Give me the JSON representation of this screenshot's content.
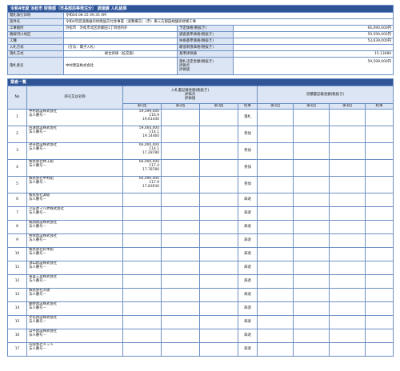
{
  "header": {
    "title": "令和4年度 浜松市 財務部（市長部局等発注分） 調達課 入札結果"
  },
  "summary": {
    "left": [
      {
        "label": "開札執行日時",
        "value": "令和04-08-25 09:35 AM"
      },
      {
        "label": "案件名",
        "value": "令和4年度道路維持修繕国交付金事業（道整備交）（市）東三方都田線舗装修繕工事"
      },
      {
        "label": "工事箇所",
        "value": "浜松市　浜松市北区新都田1丁目他内外"
      },
      {
        "label": "路線河川地区",
        "value": ""
      },
      {
        "label": "工種",
        "value": ""
      },
      {
        "label": "入札方式",
        "value": "（方法：電子入札）"
      },
      {
        "label": "落札方式",
        "value": "総合評価（拡充版）"
      },
      {
        "label": "落札者名",
        "value": "中村建設株式会社"
      }
    ],
    "right": [
      {
        "label": "予定価格(税抜き)",
        "value": "66,090,000円"
      },
      {
        "label": "調査基準価格(税抜き)",
        "value": "59,599,000円"
      },
      {
        "label": "失格基準価格(税抜き)",
        "value": "53,639,000円"
      },
      {
        "label": "最低制限価格(税抜き)",
        "value": ""
      },
      {
        "label": "基準評価値",
        "value": "15.13080"
      },
      {
        "label": "落札決定金額(税抜き)",
        "value": "59,599,000円"
      },
      {
        "label": "評価点",
        "value": ""
      },
      {
        "label": "評価値",
        "value": ""
      }
    ]
  },
  "bids": {
    "section_title": "業者一覧",
    "col_no": "No",
    "col_name": "商号又は名称",
    "col_bid_group": "入札書記載金額(税抜き)",
    "col_bid_group2": "評価点",
    "col_bid_group3": "評価値",
    "col_neg_group": "見積書記載金額(税抜き)",
    "col_first": "第1回",
    "col_second": "第2回",
    "col_third": "第3回",
    "col_result": "結果",
    "rows": [
      {
        "no": "1",
        "name": "中村建設株式会社",
        "rep": "法人番号－",
        "amount": "59,599,000",
        "score": "116.9",
        "value": "19.61440",
        "result": "落札"
      },
      {
        "no": "2",
        "name": "西遠建設株式会社",
        "rep": "法人番号－",
        "amount": "59,464,000",
        "score": "114.1",
        "value": "19.14460",
        "result": "参加"
      },
      {
        "no": "3",
        "name": "神谷建設株式会社",
        "rep": "法人番号－",
        "amount": "66,000,000",
        "score": "114.1",
        "value": "17.28780",
        "result": "参加"
      },
      {
        "no": "4",
        "name": "株式会社林工組",
        "rep": "法人番号－",
        "amount": "66,000,000",
        "score": "117.4",
        "value": "17.78780",
        "result": "参加"
      },
      {
        "no": "5",
        "name": "株式会社中村組",
        "rep": "法人番号－",
        "amount": "66,090,000",
        "score": "117.9",
        "value": "17.83930",
        "result": "参加"
      },
      {
        "no": "6",
        "name": "株式会社源組",
        "rep": "法人番号－",
        "amount": "",
        "score": "",
        "value": "",
        "result": "辞退"
      },
      {
        "no": "7",
        "name": "小笠原マル界株式会社",
        "rep": "法人番号－",
        "amount": "",
        "score": "",
        "value": "",
        "result": "辞退"
      },
      {
        "no": "8",
        "name": "鳳翔建設株式会社",
        "rep": "法人番号－",
        "amount": "",
        "score": "",
        "value": "",
        "result": "辞退"
      },
      {
        "no": "9",
        "name": "共栄建設株式会社",
        "rep": "法人番号－",
        "amount": "",
        "score": "",
        "value": "",
        "result": "辞退"
      },
      {
        "no": "10",
        "name": "株式会社鈴木組",
        "rep": "法人番号－",
        "amount": "",
        "score": "",
        "value": "",
        "result": "辞退"
      },
      {
        "no": "11",
        "name": "須山建設株式会社",
        "rep": "法人番号－",
        "amount": "",
        "score": "",
        "value": "",
        "result": "辞退"
      },
      {
        "no": "12",
        "name": "東盛工業株式会社",
        "rep": "法人番号－",
        "amount": "",
        "score": "",
        "value": "",
        "result": "辞退"
      },
      {
        "no": "13",
        "name": "株式会社浜建",
        "rep": "法人番号－",
        "amount": "",
        "score": "",
        "value": "",
        "result": "辞退"
      },
      {
        "no": "14",
        "name": "藤野建設株式会社",
        "rep": "法人番号－",
        "amount": "",
        "score": "",
        "value": "",
        "result": "辞退"
      },
      {
        "no": "15",
        "name": "文化建設株式会社",
        "rep": "法人番号－",
        "amount": "",
        "score": "",
        "value": "",
        "result": "辞退"
      },
      {
        "no": "16",
        "name": "山平建設株式会社",
        "rep": "法人番号－",
        "amount": "",
        "score": "",
        "value": "",
        "result": "辞退"
      },
      {
        "no": "17",
        "name": "有限会社メット",
        "rep": "法人番号－",
        "amount": "",
        "score": "",
        "value": "",
        "result": "辞退"
      }
    ]
  }
}
